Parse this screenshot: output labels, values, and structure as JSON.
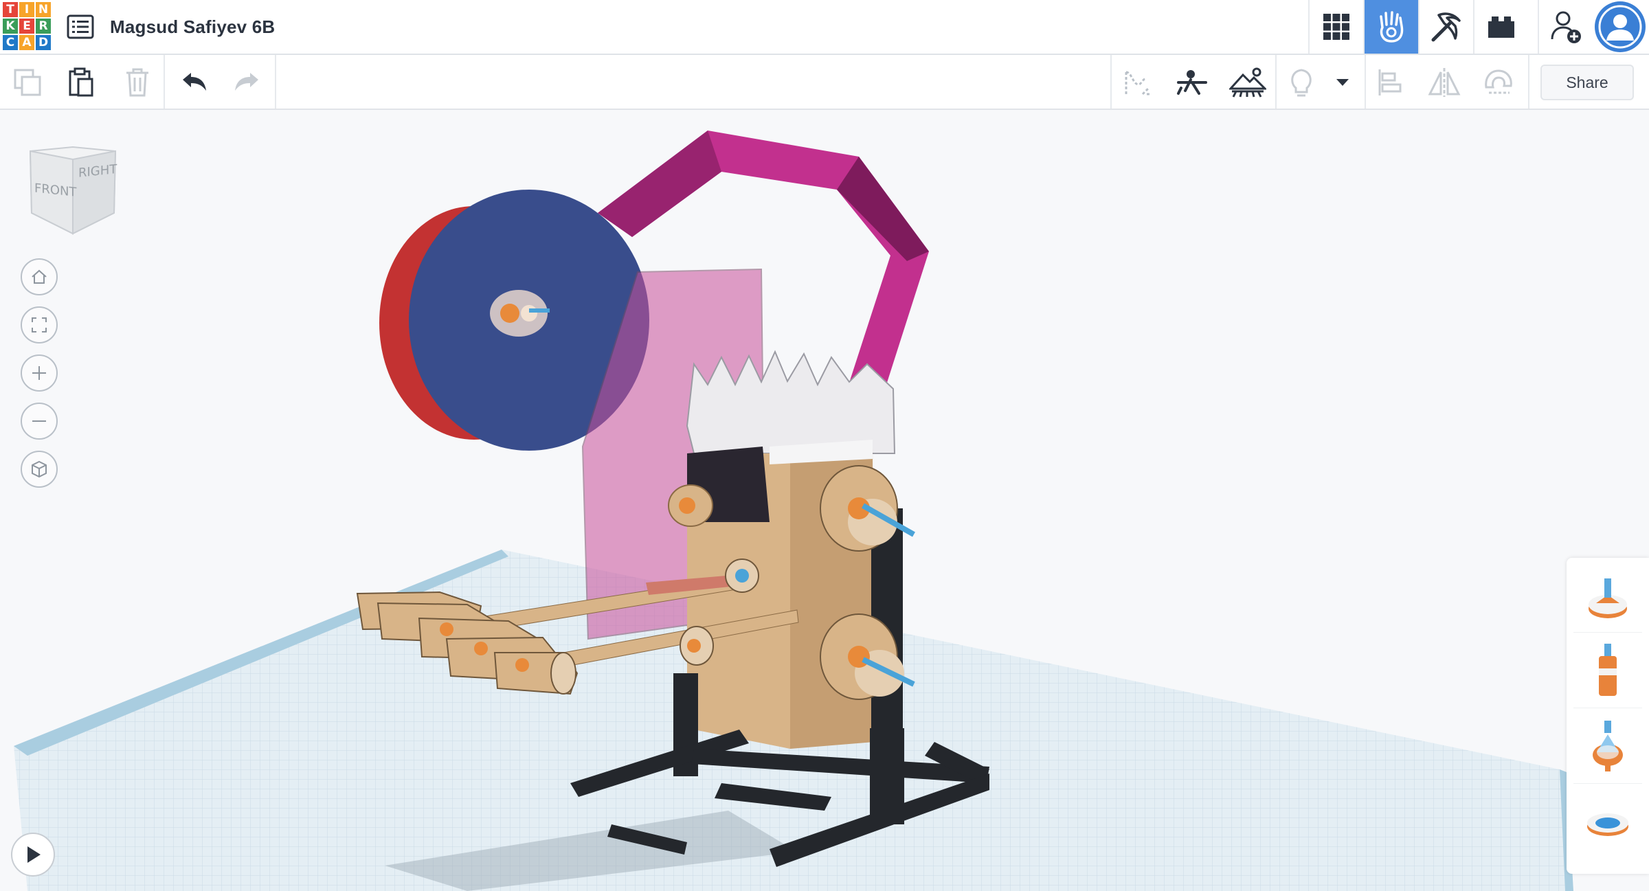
{
  "app": {
    "logo_letters": [
      "T",
      "I",
      "N",
      "K",
      "E",
      "R",
      "C",
      "A",
      "D"
    ],
    "logo_colors": [
      "#e5453a",
      "#f7a42a",
      "#f7a42a",
      "#3a9d5a",
      "#e5453a",
      "#3a9d5a",
      "#1f79c8",
      "#f7a42a",
      "#1f79c8"
    ],
    "design_title": "Magsud Safiyev 6B"
  },
  "topbar": {
    "buttons": [
      {
        "name": "3d-design-view",
        "icon": "grid-icon",
        "active": false
      },
      {
        "name": "circuits-view",
        "icon": "hand-icon",
        "active": true
      },
      {
        "name": "blocks-view",
        "icon": "pickaxe-icon",
        "active": false
      },
      {
        "name": "bricks-view",
        "icon": "brick-icon",
        "active": false
      },
      {
        "name": "invite",
        "icon": "add-user-icon",
        "active": false
      },
      {
        "name": "profile",
        "icon": "avatar-icon",
        "active": false
      }
    ]
  },
  "toolbar": {
    "left_tools": [
      "copy-icon",
      "paste-icon",
      "trash-icon",
      "undo-icon",
      "redo-icon"
    ],
    "right_tools": [
      "note-icon",
      "ruler-icon",
      "workplane-icon",
      "lightbulb-icon",
      "dropdown-icon",
      "align-icon",
      "mirror-icon",
      "magnet-icon"
    ],
    "share_label": "Share"
  },
  "view_cube": {
    "front_label": "FRONT",
    "right_label": "RIGHT"
  },
  "nav_controls": [
    "home-icon",
    "fit-view-icon",
    "zoom-in-icon",
    "zoom-out-icon",
    "perspective-icon"
  ],
  "shape_panel": {
    "items": [
      "sim-shape-top-icon",
      "sim-shape-bottle-icon",
      "sim-shape-drop-icon",
      "sim-shape-ring-icon"
    ]
  },
  "colors": {
    "accent": "#4f8fe0",
    "grid": "#cfe0ea",
    "magenta_arch": "#c2308e",
    "blue_disc": "#394d8c",
    "red_disc": "#c33232",
    "wood": "#d8b488",
    "frame": "#24272c"
  }
}
